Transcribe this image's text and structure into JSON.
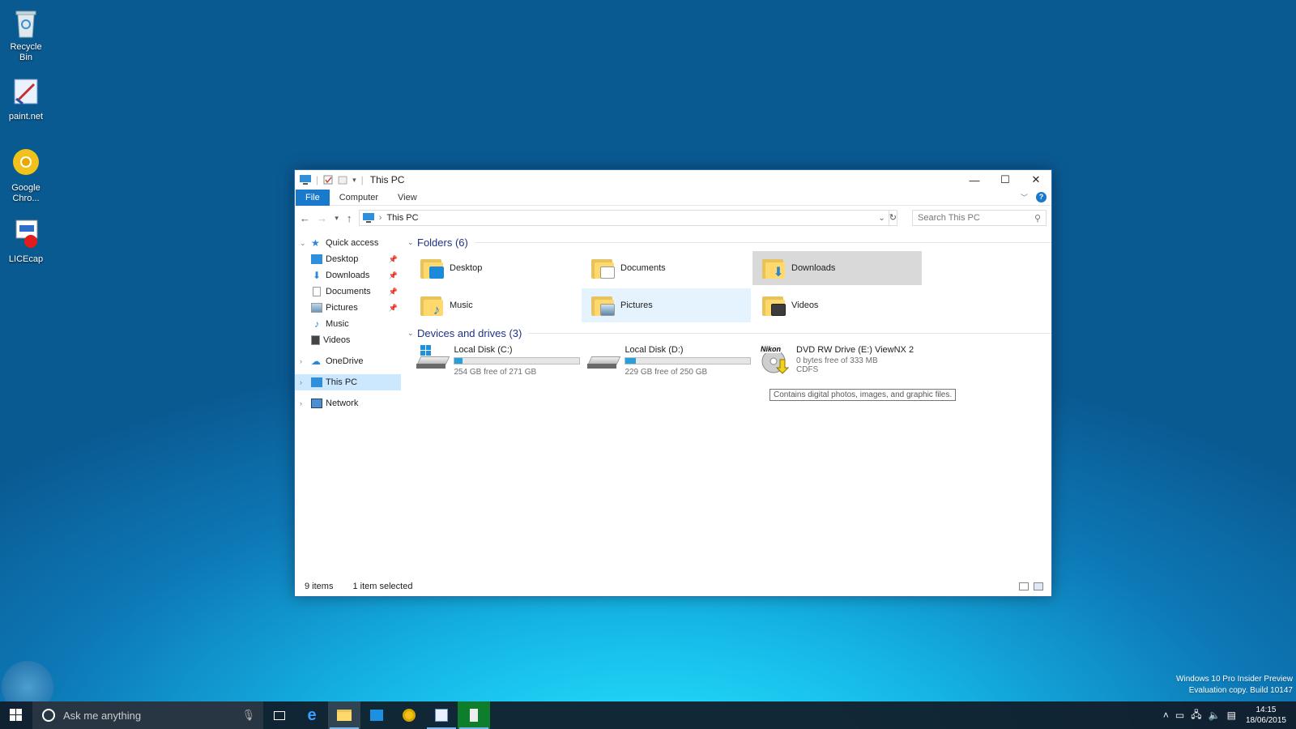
{
  "desktop": {
    "icons": [
      {
        "label": "Recycle Bin"
      },
      {
        "label": "paint.net"
      },
      {
        "label": "Google Chro..."
      },
      {
        "label": "LICEcap"
      }
    ]
  },
  "window": {
    "title": "This PC",
    "ribbon": {
      "tabs": [
        "File",
        "Computer",
        "View"
      ]
    },
    "address": {
      "location": "This PC"
    },
    "search": {
      "placeholder": "Search This PC"
    },
    "nav": {
      "quick_access": "Quick access",
      "quick_items": [
        "Desktop",
        "Downloads",
        "Documents",
        "Pictures",
        "Music",
        "Videos"
      ],
      "onedrive": "OneDrive",
      "this_pc": "This PC",
      "network": "Network"
    },
    "folders": {
      "header": "Folders (6)",
      "items": [
        {
          "name": "Desktop",
          "color": "#1c8adb"
        },
        {
          "name": "Documents",
          "color": "#ffffff"
        },
        {
          "name": "Downloads",
          "color": "#2b86d9"
        },
        {
          "name": "Music",
          "color": "#2b86d9"
        },
        {
          "name": "Pictures",
          "color": "#6aa3c9"
        },
        {
          "name": "Videos",
          "color": "#3c3c3c"
        }
      ]
    },
    "tooltip": "Contains digital photos, images, and graphic files.",
    "devices": {
      "header": "Devices and drives (3)",
      "items": [
        {
          "name": "Local Disk (C:)",
          "free": "254 GB free of 271 GB",
          "used_fraction": 0.063
        },
        {
          "name": "Local Disk (D:)",
          "free": "229 GB free of 250 GB",
          "used_fraction": 0.084
        },
        {
          "name": "DVD RW Drive (E:) ViewNX 2",
          "free": "0 bytes free of 333 MB",
          "fs": "CDFS",
          "brand": "Nikon"
        }
      ]
    },
    "status": {
      "items": "9 items",
      "selected": "1 item selected"
    }
  },
  "taskbar": {
    "search_placeholder": "Ask me anything",
    "time": "14:15",
    "date": "18/06/2015"
  },
  "watermark": {
    "line1": "Windows 10 Pro Insider Preview",
    "line2": "Evaluation copy. Build 10147"
  }
}
